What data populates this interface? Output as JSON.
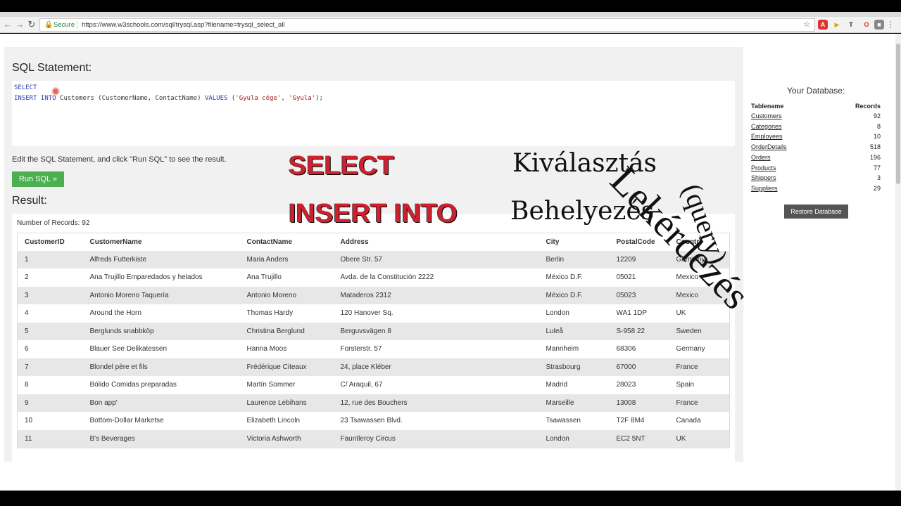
{
  "browser": {
    "secure_label": "Secure",
    "url": "https://www.w3schools.com/sql/trysql.asp?filename=trysql_select_all"
  },
  "editor": {
    "heading": "SQL Statement:",
    "line1_kw": "SELECT",
    "line2_kw": "INSERT INTO",
    "line2_table": " Customers (CustomerName, ContactName) ",
    "line2_values_kw": "VALUES",
    "line2_open": " (",
    "line2_str1": "'Gyula cége'",
    "line2_comma": ", ",
    "line2_str2": "'Gyula'",
    "line2_close": ");",
    "hint": "Edit the SQL Statement, and click \"Run SQL\" to see the result.",
    "run_button": "Run SQL »"
  },
  "result": {
    "heading": "Result:",
    "record_count": "Number of Records: 92",
    "columns": [
      "CustomerID",
      "CustomerName",
      "ContactName",
      "Address",
      "City",
      "PostalCode",
      "Country"
    ],
    "rows": [
      [
        "1",
        "Alfreds Futterkiste",
        "Maria Anders",
        "Obere Str. 57",
        "Berlin",
        "12209",
        "Germany"
      ],
      [
        "2",
        "Ana Trujillo Emparedados y helados",
        "Ana Trujillo",
        "Avda. de la Constitución 2222",
        "México D.F.",
        "05021",
        "Mexico"
      ],
      [
        "3",
        "Antonio Moreno Taquería",
        "Antonio Moreno",
        "Mataderos 2312",
        "México D.F.",
        "05023",
        "Mexico"
      ],
      [
        "4",
        "Around the Horn",
        "Thomas Hardy",
        "120 Hanover Sq.",
        "London",
        "WA1 1DP",
        "UK"
      ],
      [
        "5",
        "Berglunds snabbköp",
        "Christina Berglund",
        "Berguvsvägen 8",
        "Luleå",
        "S-958 22",
        "Sweden"
      ],
      [
        "6",
        "Blauer See Delikatessen",
        "Hanna Moos",
        "Forsterstr. 57",
        "Mannheim",
        "68306",
        "Germany"
      ],
      [
        "7",
        "Blondel père et fils",
        "Frédérique Citeaux",
        "24, place Kléber",
        "Strasbourg",
        "67000",
        "France"
      ],
      [
        "8",
        "Bólido Comidas preparadas",
        "Martín Sommer",
        "C/ Araquil, 67",
        "Madrid",
        "28023",
        "Spain"
      ],
      [
        "9",
        "Bon app'",
        "Laurence Lebihans",
        "12, rue des Bouchers",
        "Marseille",
        "13008",
        "France"
      ],
      [
        "10",
        "Bottom-Dollar Marketse",
        "Elizabeth Lincoln",
        "23 Tsawassen Blvd.",
        "Tsawassen",
        "T2F 8M4",
        "Canada"
      ],
      [
        "11",
        "B's Beverages",
        "Victoria Ashworth",
        "Fauntleroy Circus",
        "London",
        "EC2 5NT",
        "UK"
      ]
    ]
  },
  "database": {
    "heading": "Your Database:",
    "col_table": "Tablename",
    "col_records": "Records",
    "tables": [
      {
        "name": "Customers",
        "records": "92"
      },
      {
        "name": "Categories",
        "records": "8"
      },
      {
        "name": "Employees",
        "records": "10"
      },
      {
        "name": "OrderDetails",
        "records": "518"
      },
      {
        "name": "Orders",
        "records": "196"
      },
      {
        "name": "Products",
        "records": "77"
      },
      {
        "name": "Shippers",
        "records": "3"
      },
      {
        "name": "Suppliers",
        "records": "29"
      }
    ],
    "restore_button": "Restore Database"
  },
  "overlay": {
    "select": "SELECT",
    "insert_into": "INSERT INTO",
    "kivalasztas": "Kiválasztás",
    "behelyezes": "Behelyezés",
    "lekerdezes": "Lekérdezés",
    "query": "(query)"
  }
}
